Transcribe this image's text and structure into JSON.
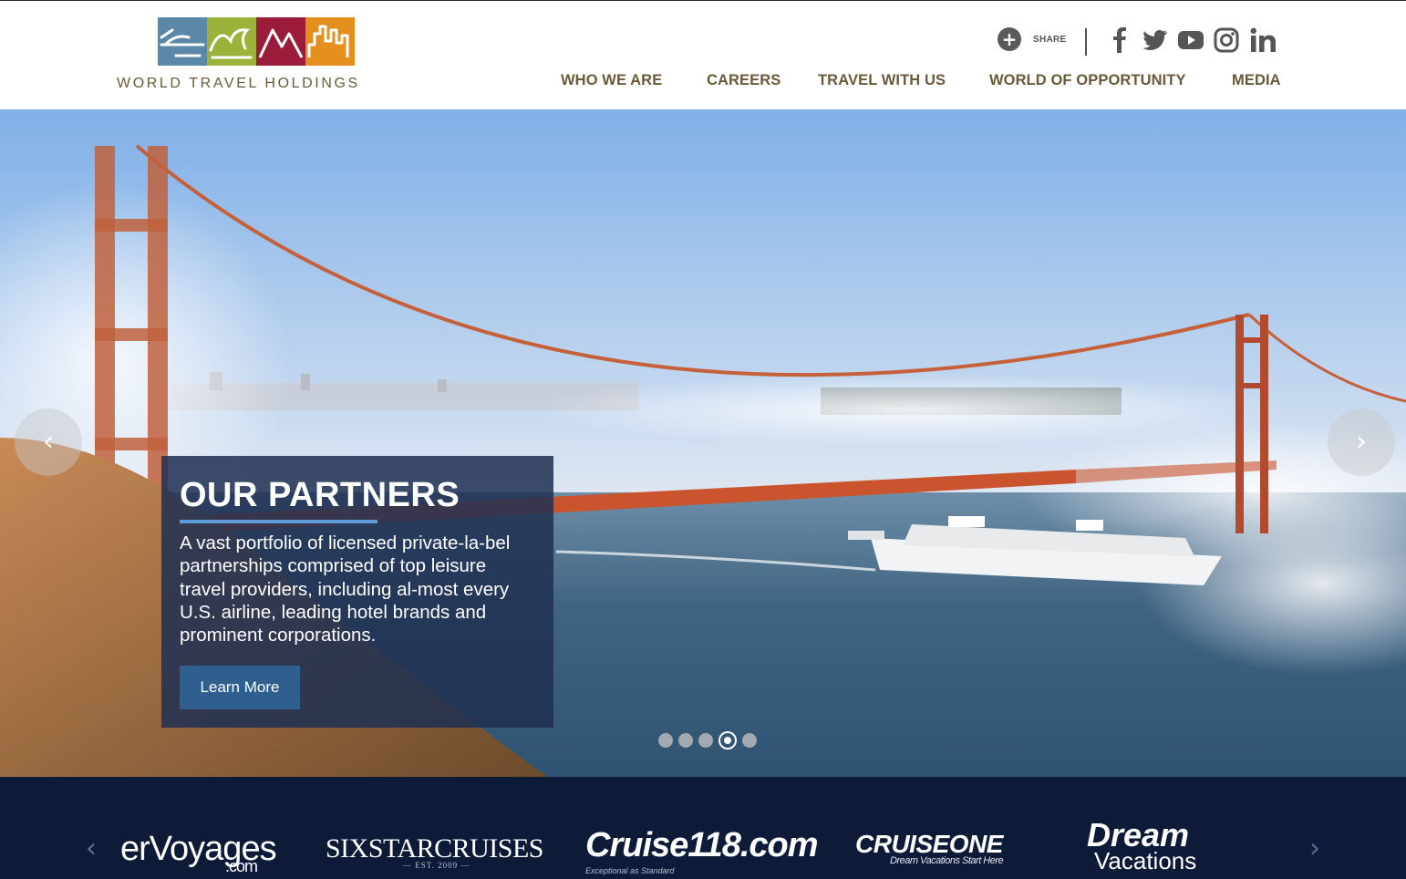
{
  "header": {
    "logo_text": "WORLD TRAVEL HOLDINGS",
    "logo_colors": [
      "#5b87a8",
      "#9bb33a",
      "#9b1b3a",
      "#e3901f"
    ],
    "share_label": "SHARE",
    "social_icons": [
      "facebook-icon",
      "twitter-icon",
      "youtube-icon",
      "instagram-icon",
      "linkedin-icon"
    ],
    "nav": [
      "WHO WE ARE",
      "CAREERS",
      "TRAVEL WITH US",
      "WORLD OF OPPORTUNITY",
      "MEDIA"
    ]
  },
  "hero": {
    "slide_title": "OUR PARTNERS",
    "slide_body": "A vast portfolio of licensed private-la-bel partnerships comprised of top leisure travel providers, including al-most every U.S. airline, leading hotel brands and prominent corporations.",
    "button_label": "Learn More",
    "prev_arrow": "‹",
    "next_arrow": "›",
    "slide_count": 5,
    "active_slide": 4
  },
  "partners": {
    "prev_arrow": "‹",
    "next_arrow": "›",
    "logos": [
      {
        "name": "erVoyages",
        "sub": ".com"
      },
      {
        "name": "SIXSTARCRUISES",
        "sub": "— EST. 2009 —"
      },
      {
        "name": "Cruise118.com",
        "sub": "Exceptional as Standard"
      },
      {
        "name": "CRUISEONE",
        "sub": "Dream Vacations Start Here"
      },
      {
        "name": "Dream",
        "sub": "Vacations"
      }
    ]
  },
  "colors": {
    "nav_text": "#6b5a3a",
    "caption_bg": "#203052",
    "caption_rule": "#5b9bd8",
    "button_bg": "#2e5f8f",
    "partner_bg": "#0d1a38"
  }
}
